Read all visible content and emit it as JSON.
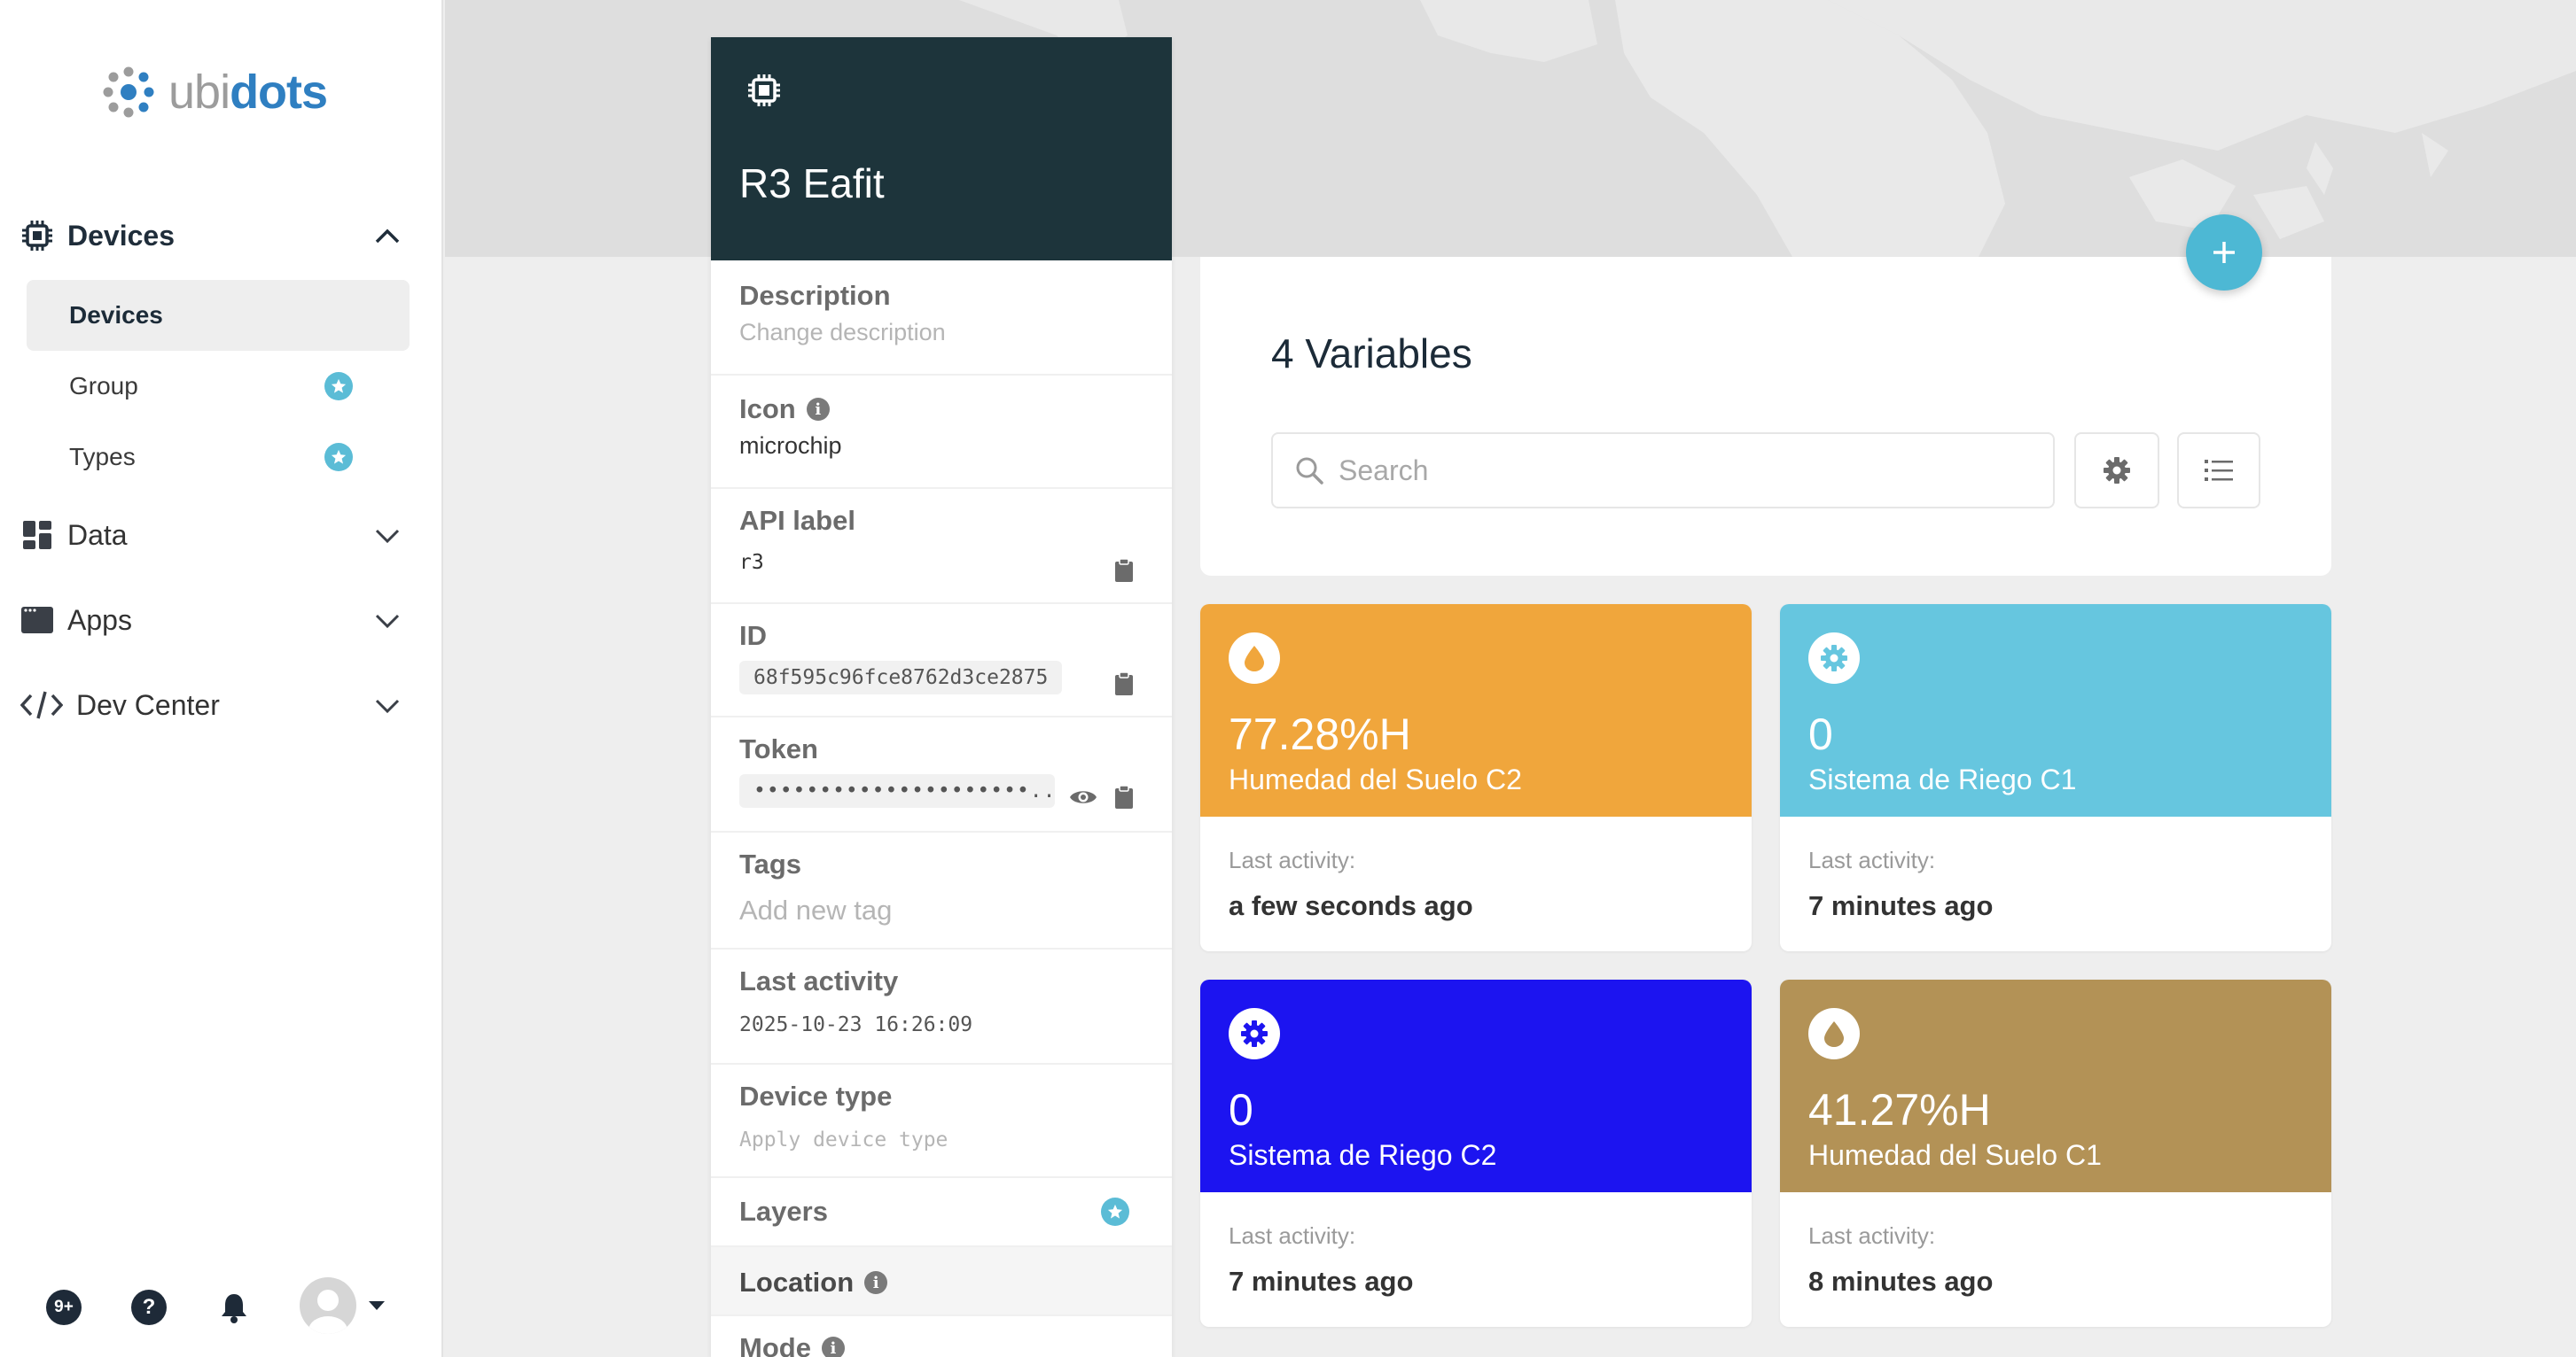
{
  "sidebar": {
    "logo": {
      "part1": "ubi",
      "part2": "dots"
    },
    "sections": [
      {
        "label": "Devices",
        "icon": "chip-icon"
      },
      {
        "label": "Data",
        "icon": "dashboard-icon"
      },
      {
        "label": "Apps",
        "icon": "window-icon"
      },
      {
        "label": "Dev Center",
        "icon": "code-icon"
      }
    ],
    "device_items": [
      {
        "label": "Devices"
      },
      {
        "label": "Group"
      },
      {
        "label": "Types"
      }
    ],
    "bottom": {
      "notifications_badge": "9+",
      "help": "?"
    }
  },
  "device": {
    "name": "R3 Eafit",
    "fields": {
      "description_label": "Description",
      "description_value": "Change description",
      "icon_label": "Icon",
      "icon_value": "microchip",
      "api_label_label": "API label",
      "api_label_value": "r3",
      "id_label": "ID",
      "id_value": "68f595c96fce8762d3ce2875",
      "token_label": "Token",
      "token_value": "•••••••••••••••••••••...",
      "tags_label": "Tags",
      "tags_value": "Add new tag",
      "last_activity_label": "Last activity",
      "last_activity_value": "2025-10-23 16:26:09",
      "device_type_label": "Device type",
      "device_type_value": "Apply device type",
      "layers_label": "Layers",
      "location_label": "Location",
      "mode_label": "Mode"
    }
  },
  "variables": {
    "title": "4 Variables",
    "search_placeholder": "Search",
    "cards": [
      {
        "value": "77.28%H",
        "name": "Humedad del Suelo C2",
        "last_activity_label": "Last activity:",
        "last_activity": "a few seconds ago",
        "color": "#f0a63c",
        "icon": "drop-icon"
      },
      {
        "value": "0",
        "name": "Sistema de Riego C1",
        "last_activity_label": "Last activity:",
        "last_activity": "7 minutes ago",
        "color": "#66c6df",
        "icon": "gear-icon"
      },
      {
        "value": "0",
        "name": "Sistema de Riego C2",
        "last_activity_label": "Last activity:",
        "last_activity": "7 minutes ago",
        "color": "#1c14f0",
        "icon": "gear-icon"
      },
      {
        "value": "41.27%H",
        "name": "Humedad del Suelo C1",
        "last_activity_label": "Last activity:",
        "last_activity": "8 minutes ago",
        "color": "#b39256",
        "icon": "drop-icon"
      }
    ]
  }
}
